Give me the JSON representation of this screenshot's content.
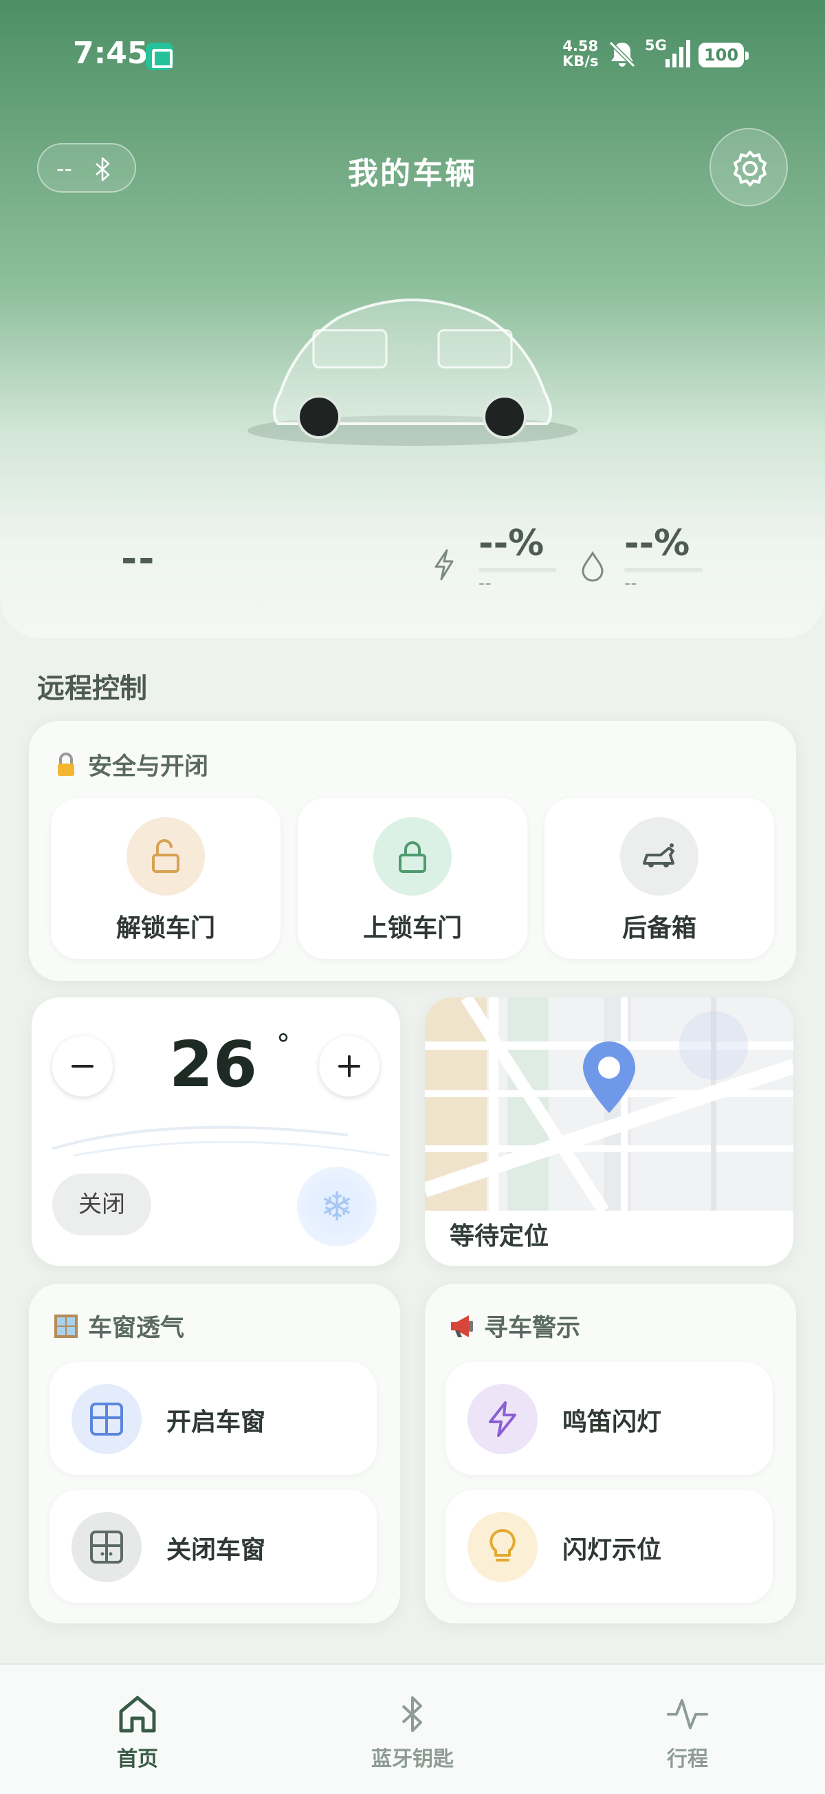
{
  "status_bar": {
    "time": "7:45",
    "net_speed_value": "4.58",
    "net_speed_unit": "KB/s",
    "network": "5G",
    "battery": "100",
    "icons": [
      "app-notification-icon",
      "mute-icon",
      "signal-icon",
      "battery-icon"
    ]
  },
  "header": {
    "title": "我的车辆",
    "bluetooth_status": "--",
    "icons": [
      "bluetooth-icon",
      "gear-icon"
    ]
  },
  "vehicle": {
    "range": "--",
    "charge_percent": "--%",
    "charge_sub": "--",
    "fuel_percent": "--%",
    "fuel_sub": "--"
  },
  "remote_control": {
    "title": "远程控制",
    "security": {
      "title": "安全与开闭",
      "emoji": "lock-icon",
      "buttons": [
        {
          "label": "解锁车门",
          "icon": "unlock-icon",
          "color": "#f7ead9"
        },
        {
          "label": "上锁车门",
          "icon": "lock-icon",
          "color": "#dcf1e6"
        },
        {
          "label": "后备箱",
          "icon": "trunk-icon",
          "color": "#eceeed"
        }
      ]
    },
    "climate": {
      "temperature": "26",
      "degree": "°",
      "off_label": "关闭",
      "icons": [
        "minus-icon",
        "plus-icon",
        "snowflake-icon"
      ]
    },
    "location": {
      "status": "等待定位",
      "icon": "map-pin-icon"
    },
    "window": {
      "title": "车窗透气",
      "emoji": "window-icon",
      "buttons": [
        {
          "label": "开启车窗",
          "icon": "window-open-icon"
        },
        {
          "label": "关闭车窗",
          "icon": "window-close-icon"
        }
      ]
    },
    "find_car": {
      "title": "寻车警示",
      "emoji": "megaphone-icon",
      "buttons": [
        {
          "label": "鸣笛闪灯",
          "icon": "lightning-icon"
        },
        {
          "label": "闪灯示位",
          "icon": "bulb-icon"
        }
      ]
    }
  },
  "tabbar": {
    "tabs": [
      {
        "label": "首页",
        "icon": "home-icon",
        "active": true
      },
      {
        "label": "蓝牙钥匙",
        "icon": "bluetooth-icon",
        "active": false
      },
      {
        "label": "行程",
        "icon": "activity-icon",
        "active": false
      }
    ]
  },
  "colors": {
    "accent": "#4d8f66",
    "active_tab": "#3a5a48",
    "inactive_tab": "#8f9c95",
    "map_pin": "#6f98e8"
  }
}
